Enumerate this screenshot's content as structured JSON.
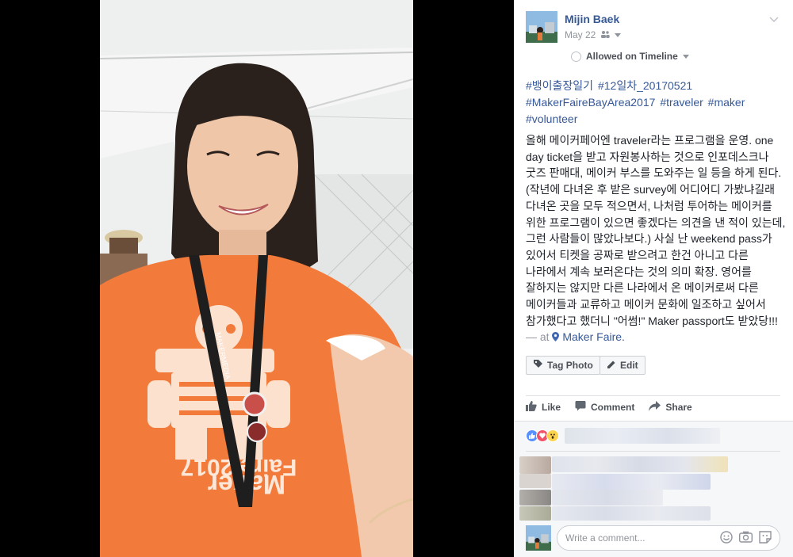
{
  "post": {
    "author": "Mijin Baek",
    "date": "May 22",
    "audience_icon": "friends-icon",
    "timeline_label": "Allowed on Timeline",
    "hashtags": [
      "#뱅이출장일기",
      "#12일차_20170521",
      "#MakerFaireBayArea2017",
      "#traveler",
      "#maker",
      "#volunteer"
    ],
    "body": "올해 메이커페어엔 traveler라는 프로그램을 운영. one day ticket을 받고 자원봉사하는 것으로 인포데스크나 굿즈 판매대, 메이커 부스를 도와주는 일 등을 하게 된다. (작년에 다녀온 후 받은 survey에 어디어디 가봤냐길래 다녀온 곳을 모두 적으면서, 나처럼 투어하는 메이커를 위한 프로그램이 있으면 좋겠다는 의견을 낸 적이 있는데, 그런 사람들이 많았나보다.) 사실 난 weekend pass가 있어서 티켓을 공짜로 받으려고 한건 아니고 다른 나라에서 계속 보러온다는 것의 의미 확장. 영어를 잘하지는 않지만 다른 나라에서 온 메이커로써 다른 메이커들과 교류하고 메이커 문화에 일조하고 싶어서 참가했다고 했더니 \"어썸!\" Maker passport도 받았당!!!",
    "at_prefix": "— at",
    "location": "Maker Faire."
  },
  "buttons": {
    "tag_photo": "Tag Photo",
    "edit": "Edit"
  },
  "actions": {
    "like": "Like",
    "comment": "Comment",
    "share": "Share"
  },
  "comment_input": {
    "placeholder": "Write a comment..."
  },
  "photo": {
    "shirt_text_1": "Maker",
    "shirt_text_2": "Faire 2017",
    "lanyard_text": "MAKERMEDIA"
  },
  "colors": {
    "link": "#365899",
    "shirt": "#f27a3a",
    "like_blue": "#5890ff",
    "love_red": "#f25268",
    "wow_yellow": "#fcd34f"
  }
}
